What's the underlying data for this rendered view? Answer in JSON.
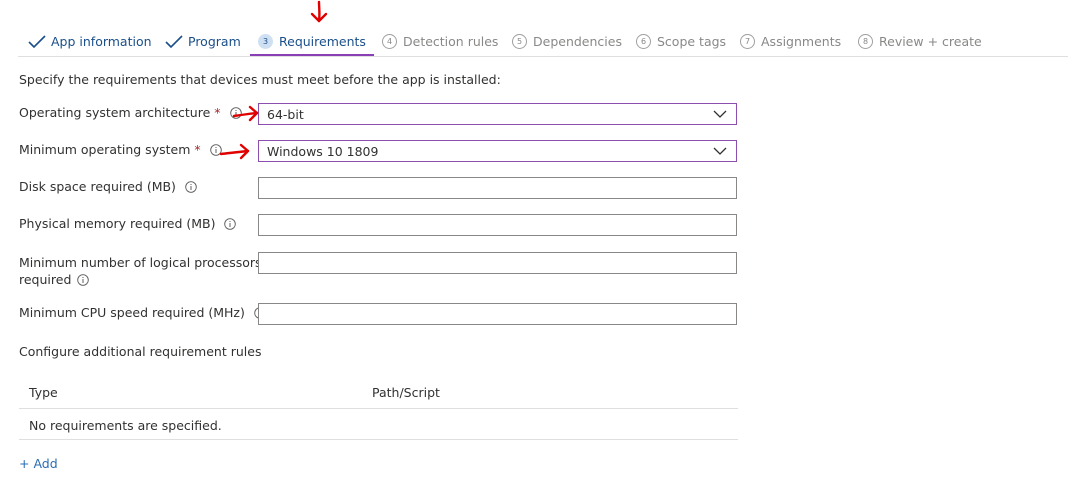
{
  "steps": [
    {
      "label": "App information",
      "state": "done"
    },
    {
      "label": "Program",
      "state": "done"
    },
    {
      "number": "3",
      "label": "Requirements",
      "state": "active"
    },
    {
      "number": "4",
      "label": "Detection rules",
      "state": "pending"
    },
    {
      "number": "5",
      "label": "Dependencies",
      "state": "pending"
    },
    {
      "number": "6",
      "label": "Scope tags",
      "state": "pending"
    },
    {
      "number": "7",
      "label": "Assignments",
      "state": "pending"
    },
    {
      "number": "8",
      "label": "Review + create",
      "state": "pending"
    }
  ],
  "intro": "Specify the requirements that devices must meet before the app is installed:",
  "fields": {
    "os_architecture": {
      "label": "Operating system architecture",
      "required": "*",
      "value": "64-bit"
    },
    "min_os": {
      "label": "Minimum operating system",
      "required": "*",
      "value": "Windows 10 1809"
    },
    "disk_space": {
      "label": "Disk space required (MB)",
      "value": ""
    },
    "physical_memory": {
      "label": "Physical memory required (MB)",
      "value": ""
    },
    "logical_processors": {
      "label_line1": "Minimum number of logical processors",
      "label_line2": "required",
      "value": ""
    },
    "cpu_speed": {
      "label": "Minimum CPU speed required (MHz)",
      "value": ""
    }
  },
  "additional": {
    "title": "Configure additional requirement rules",
    "columns": [
      "Type",
      "Path/Script"
    ],
    "empty_text": "No requirements are specified.",
    "add_label": "+ Add"
  },
  "colors": {
    "accent": "#8a3fb5",
    "link": "#2a6cb3",
    "required": "#a4262c",
    "annotation": "#e00000"
  }
}
